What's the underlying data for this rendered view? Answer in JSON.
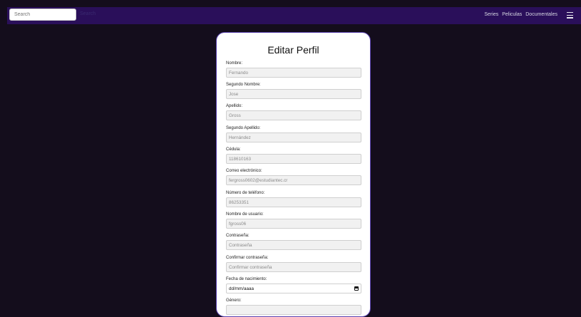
{
  "search": {
    "placeholder": "Search",
    "button_label": "Search"
  },
  "nav": {
    "items": [
      "Series",
      "Peliculas",
      "Documentales"
    ]
  },
  "form": {
    "title": "Editar Perfil",
    "fields": [
      {
        "label": "Nombre:",
        "value": "Fernando"
      },
      {
        "label": "Segundo Nombre:",
        "value": "Jose"
      },
      {
        "label": "Apellido:",
        "value": "Gross"
      },
      {
        "label": "Segundo Apellido:",
        "value": "Hernández"
      },
      {
        "label": "Cédula:",
        "value": "118610163"
      },
      {
        "label": "Correo electrónico:",
        "value": "fergross0602@estudiantec.cr"
      },
      {
        "label": "Número de teléfono:",
        "value": "86253351"
      },
      {
        "label": "Nombre de usuario:",
        "value": "fgross06"
      },
      {
        "label": "Contraseña:",
        "value": "Contraseña"
      },
      {
        "label": "Confirmar contraseña:",
        "value": "Confirmar contraseña"
      },
      {
        "label": "Fecha de nacimiento:",
        "value": "dd/mm/aaaa"
      },
      {
        "label": "Género:",
        "value": ""
      }
    ]
  }
}
